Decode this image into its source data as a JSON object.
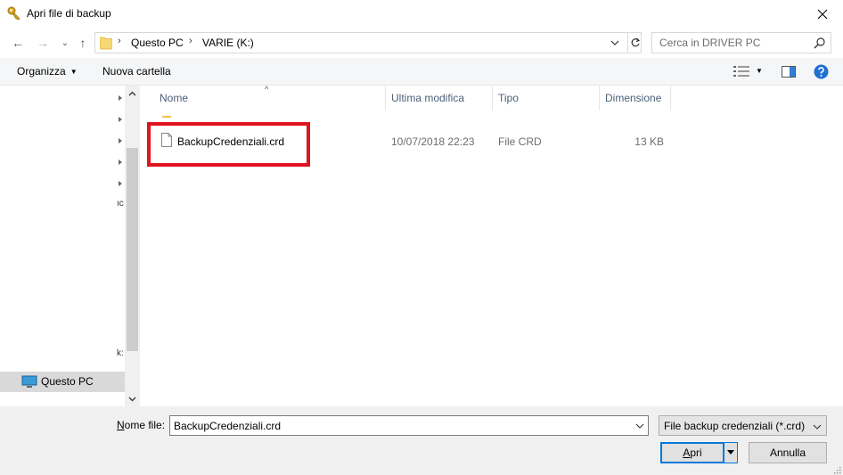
{
  "window": {
    "title": "Apri file di backup",
    "close_glyph": "✕"
  },
  "address": {
    "crumbs": [
      "Questo PC",
      "VARIE (K:)"
    ],
    "sep": "›",
    "search_placeholder": "Cerca in DRIVER PC"
  },
  "nav_buttons": {
    "back": "←",
    "forward": "→",
    "recent": "⌄",
    "up": "↑"
  },
  "toolbar": {
    "organize": "Organizza",
    "organize_caret": "▼",
    "new_folder": "Nuova cartella",
    "views_caret": "▼"
  },
  "navpane": {
    "clipped_1": "ıc",
    "clipped_2": "k:",
    "selected_label": "Questo PC"
  },
  "columns": [
    "Nome",
    "Ultima modifica",
    "Tipo",
    "Dimensione"
  ],
  "sort_caret": "^",
  "files": [
    {
      "name": "BackupCredenziali.crd",
      "modified": "10/07/2018 22:23",
      "type": "File CRD",
      "size": "13 KB"
    }
  ],
  "footer": {
    "filename_label_u": "N",
    "filename_label_rest": "ome file:",
    "filename_value": "BackupCredenziali.crd",
    "filter_value": "File backup credenziali (*.crd)",
    "open_u": "A",
    "open_rest": "pri",
    "cancel": "Annulla"
  },
  "colors": {
    "accent": "#0078d7",
    "highlight": "#e0141e",
    "folder": "#f0c24a"
  }
}
